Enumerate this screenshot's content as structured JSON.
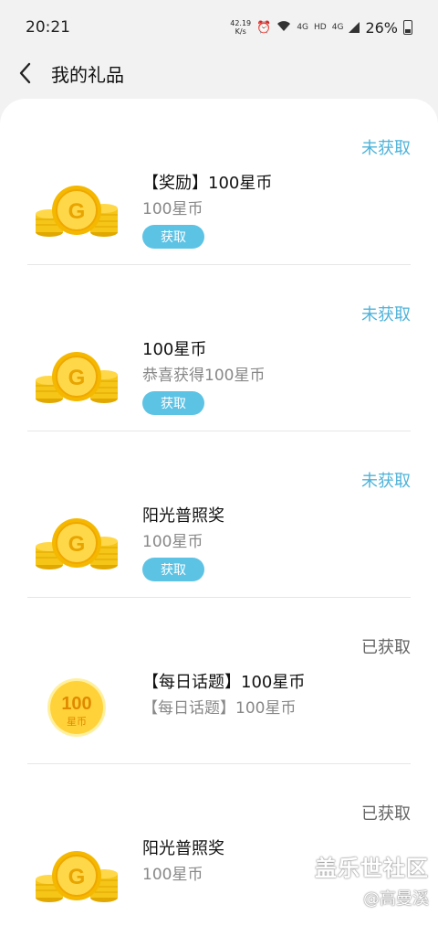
{
  "status_bar": {
    "time": "20:21",
    "speed_value": "42.19",
    "speed_unit": "K/s",
    "network_1": "4G",
    "hd": "HD",
    "network_2": "4G",
    "battery": "26%"
  },
  "header": {
    "title": "我的礼品",
    "back_icon": "chevron-left-icon"
  },
  "gifts": [
    {
      "status": "未获取",
      "title": "【奖励】100星币",
      "subtitle": "100星币",
      "button": "获取",
      "icon": "coin-stack-icon"
    },
    {
      "status": "未获取",
      "title": "100星币",
      "subtitle": "恭喜获得100星币",
      "button": "获取",
      "icon": "coin-stack-icon"
    },
    {
      "status": "未获取",
      "title": "阳光普照奖",
      "subtitle": "100星币",
      "button": "获取",
      "icon": "coin-stack-icon"
    },
    {
      "status": "已获取",
      "title": "【每日话题】100星币",
      "subtitle": "【每日话题】100星币",
      "icon": "single-coin-icon",
      "coin_value": "100",
      "coin_text": "星币"
    },
    {
      "status": "已获取",
      "title": "阳光普照奖",
      "subtitle": "100星币",
      "icon": "coin-stack-icon"
    }
  ],
  "watermark": {
    "brand": "盖乐世社区",
    "author": "@高曼溪"
  },
  "colors": {
    "unclaimed": "#4fb3d9",
    "button": "#5dc3e5",
    "coin": "#f5c518"
  }
}
